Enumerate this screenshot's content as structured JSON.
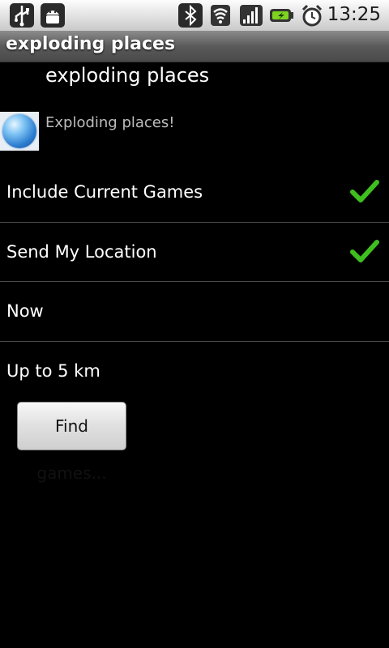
{
  "status_bar": {
    "time": "13:25",
    "icons": [
      "usb-icon",
      "android-debug-icon",
      "bluetooth-icon",
      "wifi-icon",
      "signal-icon",
      "battery-charging-icon",
      "alarm-icon"
    ]
  },
  "title_bar": {
    "title": "exploding places"
  },
  "header": {
    "app_name": "exploding places",
    "description": "Exploding places!"
  },
  "settings": {
    "include_current_games": {
      "label": "Include Current Games",
      "checked": true
    },
    "send_my_location": {
      "label": "Send My Location",
      "checked": true
    },
    "when": {
      "label": "Now"
    },
    "distance": {
      "label": "Up to 5 km"
    }
  },
  "actions": {
    "find_games_label": "Find games..."
  },
  "colors": {
    "check_green": "#3fbf1f",
    "background": "#000000"
  }
}
